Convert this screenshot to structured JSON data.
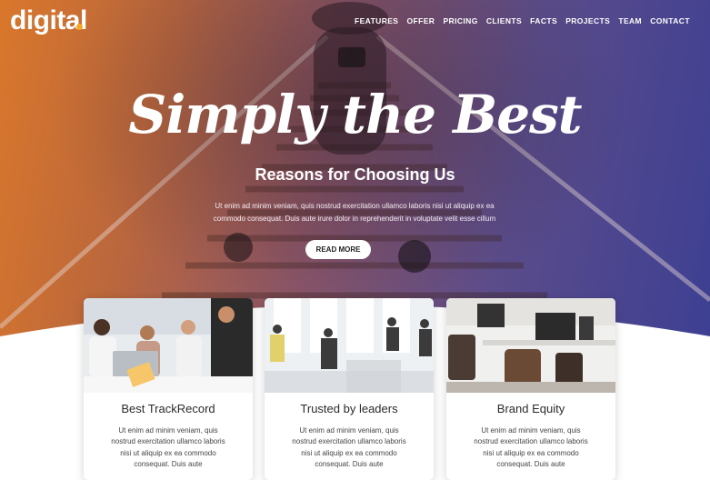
{
  "brand": {
    "logo": "digital"
  },
  "nav": {
    "items": [
      "FEATURES",
      "OFFER",
      "PRICING",
      "CLIENTS",
      "FACTS",
      "PROJECTS",
      "TEAM",
      "CONTACT"
    ]
  },
  "hero": {
    "script_title": "Simply the Best",
    "subtitle": "Reasons for Choosing Us",
    "text_line1": "Ut enim ad minim veniam, quis nostrud exercitation ullamco laboris nisi ut aliquip ex ea",
    "text_line2": "commodo consequat. Duis aute irure dolor in reprehenderit in voluptate velit esse cillum",
    "button": "READ MORE"
  },
  "cards": [
    {
      "title": "Best TrackRecord",
      "text": "Ut enim ad minim veniam, quis nostrud exercitation ullamco laboris nisi ut aliquip ex ea commodo consequat. Duis aute"
    },
    {
      "title": "Trusted by leaders",
      "text": "Ut enim ad minim veniam, quis nostrud exercitation ullamco laboris nisi ut aliquip ex ea commodo consequat. Duis aute"
    },
    {
      "title": "Brand Equity",
      "text": "Ut enim ad minim veniam, quis nostrud exercitation ullamco laboris nisi ut aliquip ex ea commodo consequat. Duis aute"
    }
  ],
  "colors": {
    "accent": "#f5a623",
    "gradient_start": "#d9772b",
    "gradient_end": "#3d3f93"
  }
}
